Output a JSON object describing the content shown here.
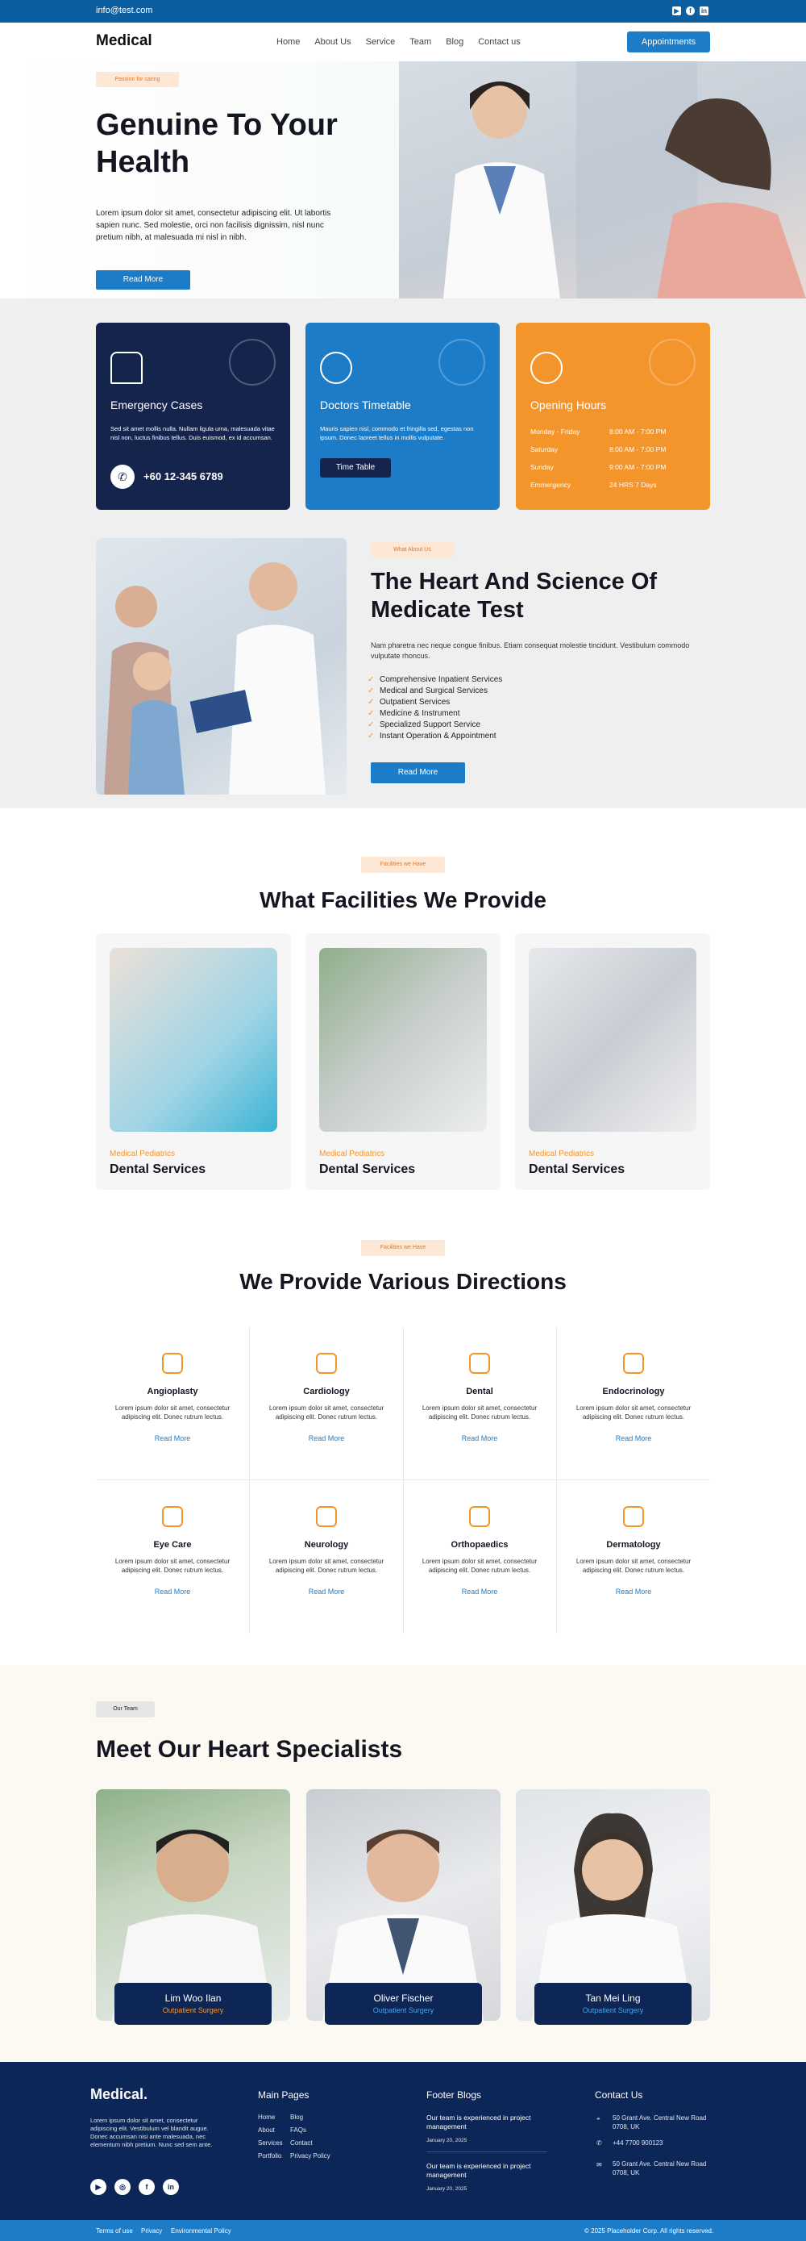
{
  "topbar": {
    "email": "info@test.com",
    "social": [
      "youtube-icon",
      "facebook-icon",
      "linkedin-icon"
    ]
  },
  "nav": {
    "logo": "Medical",
    "menu": [
      "Home",
      "About Us",
      "Service",
      "Team",
      "Blog",
      "Contact us"
    ],
    "cta": "Appointments"
  },
  "hero": {
    "tag": "Passion for caring",
    "title": "Genuine To Your Health",
    "text": "Lorem ipsum dolor sit amet, consectetur adipiscing elit. Ut labortis sapien nunc. Sed molestie, orci non facilisis dignissim, nisl nunc pretium nibh, at malesuada mi nisl in nibh.",
    "button": "Read More"
  },
  "cards": {
    "emergency": {
      "title": "Emergency Cases",
      "text": "Sed sit amet mollis nulla. Nullam ligula urna, malesuada vitae nisl non, luctus finibus tellus. Duis euismod, ex id accumsan.",
      "phone": "+60 12-345 6789"
    },
    "doctors": {
      "title": "Doctors Timetable",
      "text": "Mauris sapien nisl, commodo et fringilla sed, egestas non ipsum. Donec laoreet tellus in mollis vulputate.",
      "button": "Time Table"
    },
    "hours": {
      "title": "Opening Hours",
      "rows": [
        [
          "Monday - Friday",
          "8:00 AM - 7:00 PM"
        ],
        [
          "Saturday",
          "8:00 AM - 7:00 PM"
        ],
        [
          "Sunday",
          "9:00 AM - 7:00 PM"
        ],
        [
          "Emmergency",
          "24 HRS 7 Days"
        ]
      ]
    }
  },
  "about": {
    "tag": "What About Us",
    "title": "The Heart And Science Of Medicate Test",
    "text": "Nam pharetra nec neque congue finibus. Etiam consequat molestie tincidunt. Vestibulum commodo vulputate rhoncus.",
    "services": [
      "Comprehensive Inpatient Services",
      "Medical and Surgical Services",
      "Outpatient Services",
      "Medicine & Instrument",
      "Specialized Support Service",
      "Instant Operation & Appointment"
    ],
    "button": "Read More"
  },
  "facilities": {
    "tag": "Facilities we Have",
    "title": "What Facilities We Provide",
    "items": [
      {
        "sub": "Medical Pediatrics",
        "name": "Dental Services"
      },
      {
        "sub": "Medical Pediatrics",
        "name": "Dental Services"
      },
      {
        "sub": "Medical Pediatrics",
        "name": "Dental Services"
      }
    ]
  },
  "directions": {
    "tag": "Facilities we Have",
    "title": "We Provide Various Directions",
    "more": "Read More",
    "text": "Lorem ipsum dolor sit amet, consectetur adipiscing elit. Donec rutrum lectus.",
    "items": [
      "Angioplasty",
      "Cardiology",
      "Dental",
      "Endocrinology",
      "Eye Care",
      "Neurology",
      "Orthopaedics",
      "Dermatology"
    ],
    "icons": [
      "stethoscope-icon",
      "heart-pulse-icon",
      "tooth-icon",
      "molecule-icon",
      "eye-icon",
      "brain-icon",
      "bone-icon",
      "skin-icon"
    ]
  },
  "team": {
    "tag": "Our Team",
    "title": "Meet Our Heart Specialists",
    "members": [
      {
        "name": "Lim Woo Ilan",
        "role": "Outpatient Surgery"
      },
      {
        "name": "Oliver Fischer",
        "role": "Outpatient Surgery"
      },
      {
        "name": "Tan Mei Ling",
        "role": "Outpatient Surgery"
      }
    ]
  },
  "footer": {
    "logo": "Medical.",
    "about": "Lorem ipsum dolor sit amet, consectetur adipiscing elit. Vestibulum vel blandit augue. Donec accumsan nisi ante malesuada, nec elementum nibh pretium. Nunc sed sem ante.",
    "main_pages_title": "Main Pages",
    "main_pages": [
      "Home",
      "Blog",
      "About",
      "FAQs",
      "Services",
      "Contact",
      "Portfolio",
      "Privacy Policy"
    ],
    "blogs_title": "Footer Blogs",
    "blogs": [
      {
        "title": "Our team is experienced in project management",
        "date": "January 20, 2025"
      },
      {
        "title": "Our team is experienced in project management",
        "date": "January 20, 2025"
      }
    ],
    "contact_title": "Contact Us",
    "contact": [
      "50 Grant Ave. Central New Road 0708, UK",
      "+44 7700 900123",
      "50 Grant Ave. Central New Road 0708, UK"
    ],
    "bottom_links": [
      "Terms of use",
      "Privacy",
      "Environmental Policy"
    ],
    "copyright": "© 2025 Placeholder Corp. All rights reserved."
  }
}
